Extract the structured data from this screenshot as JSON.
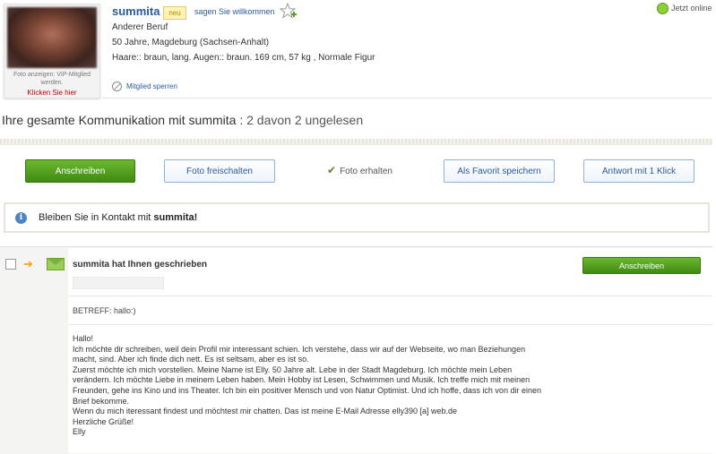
{
  "profile": {
    "name": "summita",
    "badge": "neu",
    "greet_link": "sagen Sie willkommen",
    "occupation": "Anderer Beruf",
    "age_location": "50 Jahre, Magdeburg (Sachsen-Anhalt)",
    "details": "Haare:: braun, lang. Augen:: braun. 169 cm, 57 kg , Normale Figur",
    "block_link": "Mitglied sperren",
    "photo_caption_1": "Foto anzeigen: VIP-Mitglied",
    "photo_caption_2": "werden.",
    "photo_link": "Klicken Sie hier",
    "online_status": "Jetzt online"
  },
  "communication": {
    "title_prefix": "Ihre gesamte Kommunikation mit summita :",
    "count_text": "2 davon 2 ungelesen"
  },
  "actions": {
    "write": "Anschreiben",
    "unlock_photo": "Foto freischalten",
    "photo_received": "Foto erhalten",
    "save_favorite": "Als Favorit speichern",
    "quick_reply": "Antwort mit 1 Klick"
  },
  "contact_box": {
    "text_prefix": "Bleiben Sie in Kontakt mit",
    "name": "summita!"
  },
  "message": {
    "sender_line": "summita hat Ihnen geschrieben",
    "reply_button": "Anschreiben",
    "subject": "BETREFF: hallo:)",
    "lines": [
      "Hallo!",
      "Ich möchte dir schreiben, weil dein Profil mir interessant schien. Ich verstehe, dass wir auf der Webseite, wo man Beziehungen",
      "macht, sind. Aber ich finde dich nett. Es ist seltsam, aber es ist so.",
      "Zuerst möchte ich mich vorstellen. Meine Name ist Elly. 50 Jahre alt. Lebe in der Stadt Magdeburg. Ich möchte mein Leben",
      "verändern. Ich möchte Liebe in meinem Leben haben. Mein Hobby ist Lesen, Schwimmen und Musik. Ich treffe mich mit meinen",
      "Freunden, gehe ins Kino und ins Theater. Ich bin ein positiver Mensch und von Natur Optimist. Und ich hoffe, dass ich von dir einen",
      "Brief bekomme.",
      "Wenn du mich iteressant findest und möchtest mir chatten. Das ist meine E-Mail Adresse elly390 [a] web.de",
      "Herzliche Grüße!",
      "Elly"
    ]
  },
  "colors": {
    "link_blue": "#2a5a9a",
    "green_button": "#4f9a1e",
    "online_green": "#8ed03a"
  }
}
